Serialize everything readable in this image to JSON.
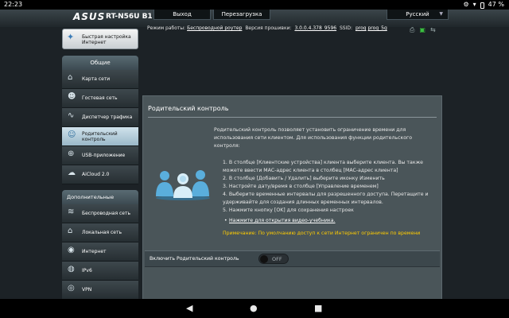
{
  "statusbar": {
    "time": "22:23",
    "battery": "47 %"
  },
  "header": {
    "brand": "ASUS",
    "model": "RT-N56U B1",
    "logout_label": "Выход",
    "reboot_label": "Перезагрузка",
    "language": "Русский"
  },
  "sidebar": {
    "qis_label": "Быстрая настройка Интернет",
    "general_header": "Общие",
    "general_items": [
      {
        "label": "Карта сети",
        "icon": "network-map-icon"
      },
      {
        "label": "Гостевая сеть",
        "icon": "guest-network-icon"
      },
      {
        "label": "Диспетчер трафика",
        "icon": "traffic-manager-icon"
      },
      {
        "label": "Родительский контроль",
        "icon": "parental-control-icon",
        "active": true
      },
      {
        "label": "USB-приложение",
        "icon": "usb-icon"
      },
      {
        "label": "AiCloud 2.0",
        "icon": "cloud-icon"
      }
    ],
    "advanced_header": "Дополнительные настройки",
    "advanced_items": [
      {
        "label": "Беспроводная сеть",
        "icon": "wireless-icon"
      },
      {
        "label": "Локальная сеть",
        "icon": "lan-icon"
      },
      {
        "label": "Интернет",
        "icon": "internet-icon"
      },
      {
        "label": "IPv6",
        "icon": "ipv6-icon"
      },
      {
        "label": "VPN",
        "icon": "vpn-icon"
      }
    ]
  },
  "opbar": {
    "mode_label": "Режим работы:",
    "mode_value": "Беспроводной роутер",
    "firmware_label": "Версия прошивки:",
    "firmware_value": "3.0.0.4.378_9596",
    "ssid_label": "SSID:",
    "ssid_1": "prog",
    "ssid_2": "prog_5g"
  },
  "panel": {
    "title": "Родительский контроль",
    "intro": "Родительский контроль позволяет установить ограничение времени для использования сети клиентом. Для использования функции родительского контроля:",
    "steps": [
      "1. В столбце [Клиентские устройства] клиента выберите клиента. Вы также можете ввести MAC-адрес клиента в столбец [MAC-адрес клиента]",
      "2. В столбце [Добавить / Удалить] выберите иконку Изменить",
      "3. Настройте дату/время в столбце [Управление временем]",
      "4. Выберите временные интервалы для разрешенного доступа. Перетащите и удерживайте для создания длинных временных интервалов.",
      "5. Нажмите кнопку [OK] для сохранения настроек"
    ],
    "video_link": "Нажмите для открытия видео-учебника.",
    "note": "Примечание: По умолчанию доступ к сети Интернет ограничен по времени",
    "toggle_label": "Включить Родительский контроль",
    "toggle_state": "OFF"
  }
}
